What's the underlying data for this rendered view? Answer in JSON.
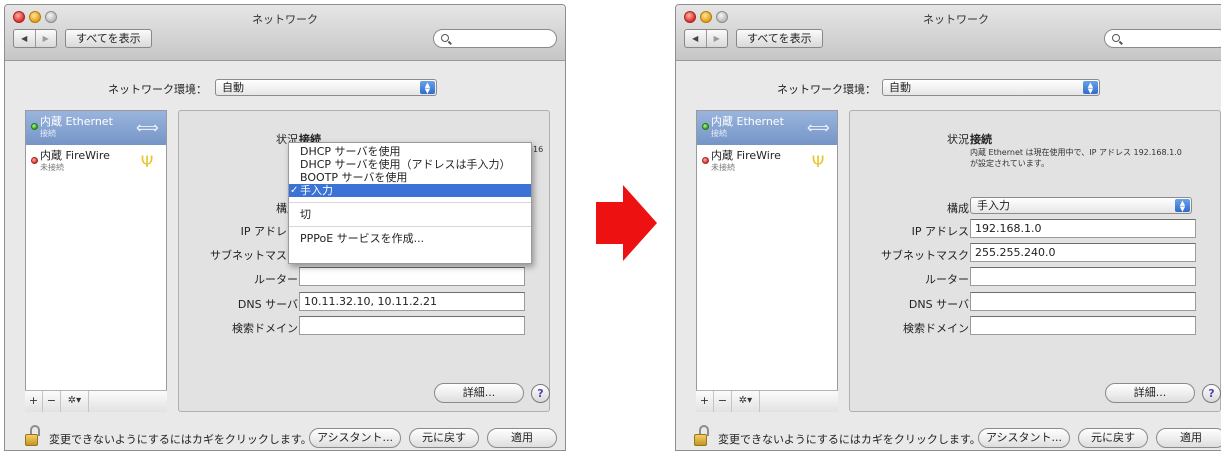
{
  "window": {
    "title": "ネットワーク",
    "show_all": "すべてを表示",
    "location_label": "ネットワーク環境：",
    "location_value": "自動"
  },
  "services": [
    {
      "name": "内蔵 Ethernet",
      "status": "接続",
      "icon": "ethernet-icon"
    },
    {
      "name": "内蔵 FireWire",
      "status": "未接続",
      "icon": "firewire-icon"
    }
  ],
  "sidebar_toolbar": {
    "add": "+",
    "remove": "−",
    "action": "✲▾"
  },
  "labels": {
    "status": "状況：",
    "config": "構成：",
    "ip": "IP アドレス：",
    "subnet": "サブネットマスク：",
    "router": "ルーター：",
    "dns": "DNS サーバ：",
    "search": "検索ドメイン："
  },
  "left": {
    "status_value": "接続",
    "status_trailing": "16",
    "dns_value": "10.11.32.10, 10.11.2.21",
    "menu": {
      "items": [
        "DHCP サーバを使用",
        "DHCP サーバを使用（アドレスは手入力）",
        "BOOTP サーバを使用",
        "手入力",
        "切",
        "PPPoE サービスを作成..."
      ],
      "selected": "手入力",
      "check": "✓"
    }
  },
  "right": {
    "status_value": "接続",
    "status_desc_1": "内蔵 Ethernet は現在使用中で、IP アドレス 192.168.1.0",
    "status_desc_2": "が設定されています。",
    "config_value": "手入力",
    "ip_value": "192.168.1.0",
    "subnet_value": "255.255.240.0"
  },
  "buttons": {
    "advanced": "詳細...",
    "help": "?",
    "assistant": "アシスタント...",
    "revert": "元に戻す",
    "apply": "適用"
  },
  "lock_text": "変更できないようにするにはカギをクリックします。",
  "colors": {
    "arrow": "#ee1111",
    "selection": "#3a72d6"
  }
}
